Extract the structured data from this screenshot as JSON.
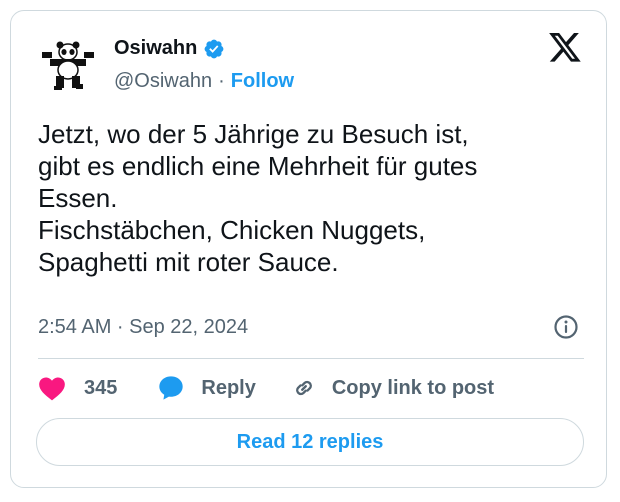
{
  "author": {
    "name": "Osiwahn",
    "handle": "@Osiwahn",
    "separator": "·",
    "follow_label": "Follow",
    "verified": true,
    "avatar_icon": "panda-icon",
    "verified_color": "#1d9bf0"
  },
  "tweet": {
    "text": "Jetzt, wo der 5 Jährige zu Besuch ist,\ngibt es endlich eine Mehrheit für gutes\nEssen.\nFischstäbchen, Chicken Nuggets,\nSpaghetti mit roter Sauce.",
    "timestamp": "2:54 AM · Sep 22, 2024"
  },
  "actions": {
    "like_count": "345",
    "reply_label": "Reply",
    "copy_label": "Copy link to post",
    "like_color": "#f91880",
    "reply_color": "#1d9bf0"
  },
  "footer": {
    "read_replies_label": "Read 12 replies"
  },
  "colors": {
    "accent": "#1d9bf0",
    "text": "#0f1419",
    "muted": "#536471",
    "border": "#cfd9de"
  }
}
